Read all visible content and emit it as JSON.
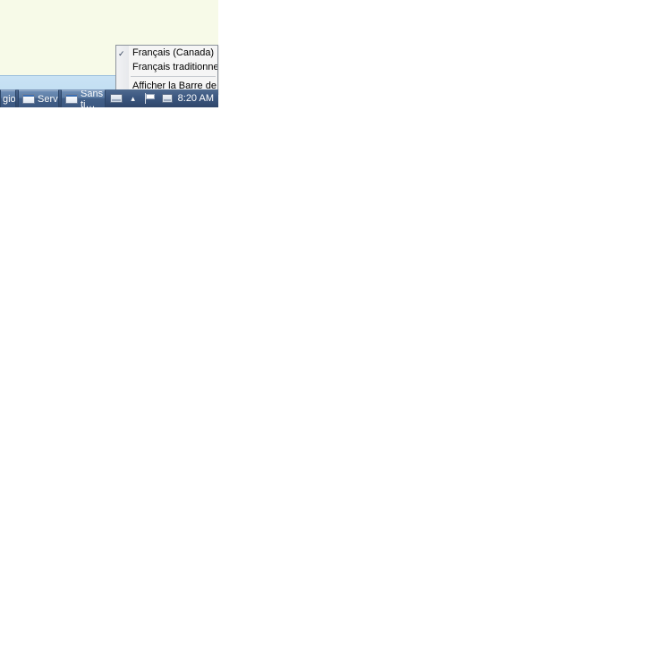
{
  "lang_menu": {
    "items": [
      {
        "label": "Français (Canada)",
        "checked": true
      },
      {
        "label": "Français traditionnel (Canada)",
        "checked": false
      }
    ],
    "show_bar_prefix": "Affi",
    "show_bar_hot": "c",
    "show_bar_suffix": "her la Barre de langue"
  },
  "taskbar": {
    "buttons": [
      {
        "label": "gio…"
      },
      {
        "label": "Servic…"
      },
      {
        "label": "Sans ti…"
      }
    ],
    "clock": "8:20 AM"
  }
}
